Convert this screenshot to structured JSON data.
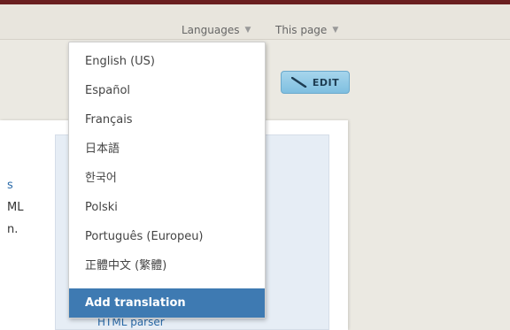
{
  "topbar": {
    "languages_label": "Languages",
    "this_page_label": "This page"
  },
  "toolbar": {
    "edit_label": "EDIT"
  },
  "content": {
    "fragment_1": "s",
    "fragment_2": "ML",
    "fragment_3": "n.",
    "html_parser_link": "HTML parser"
  },
  "dropdown": {
    "items": [
      "English (US)",
      "Español",
      "Français",
      "日本語",
      "한국어",
      "Polski",
      "Português (Europeu)",
      "正體中文 (繁體)",
      "Add translation"
    ],
    "selected_index": 8
  },
  "colors": {
    "top_border": "#6a1f1f",
    "selected_item_bg": "#3e7ab2",
    "edit_button_bg": "#8cc8e6",
    "link": "#2a6aa8"
  }
}
